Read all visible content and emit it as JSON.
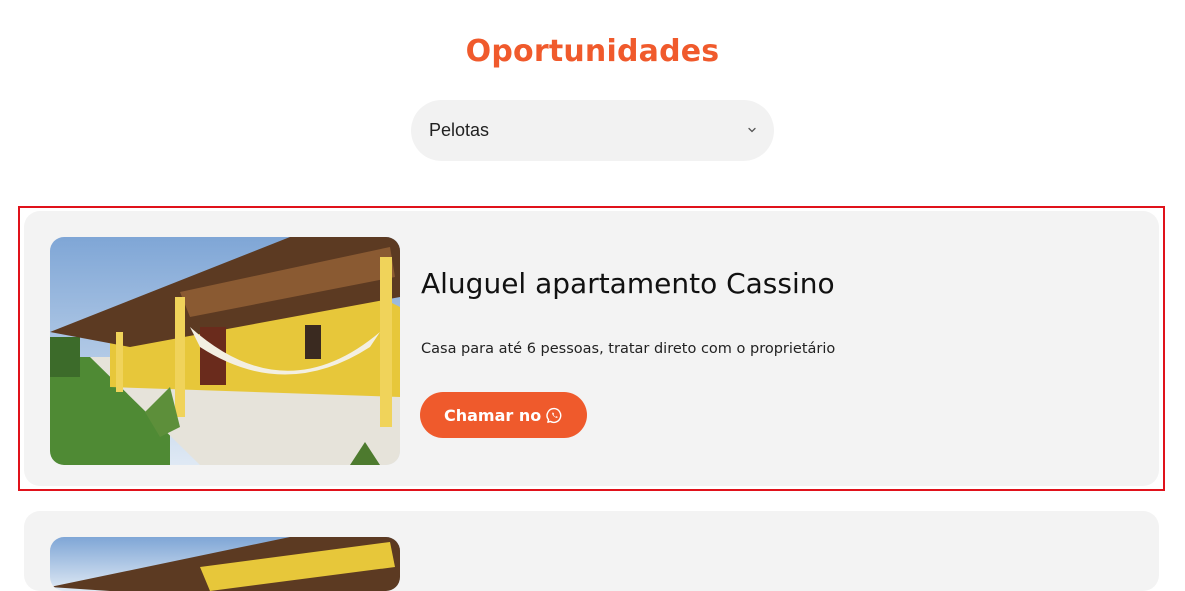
{
  "header": {
    "title": "Oportunidades"
  },
  "filter": {
    "selected": "Pelotas"
  },
  "listings": [
    {
      "title": "Aluguel apartamento Cassino",
      "description": "Casa para até 6 pessoas, tratar direto com o proprietário",
      "button_label": "Chamar no",
      "button_icon": "whatsapp-icon"
    }
  ],
  "colors": {
    "accent": "#f05a2c",
    "card_bg": "#f3f3f3",
    "select_bg": "#f2f2f2",
    "highlight": "#e0121b"
  }
}
